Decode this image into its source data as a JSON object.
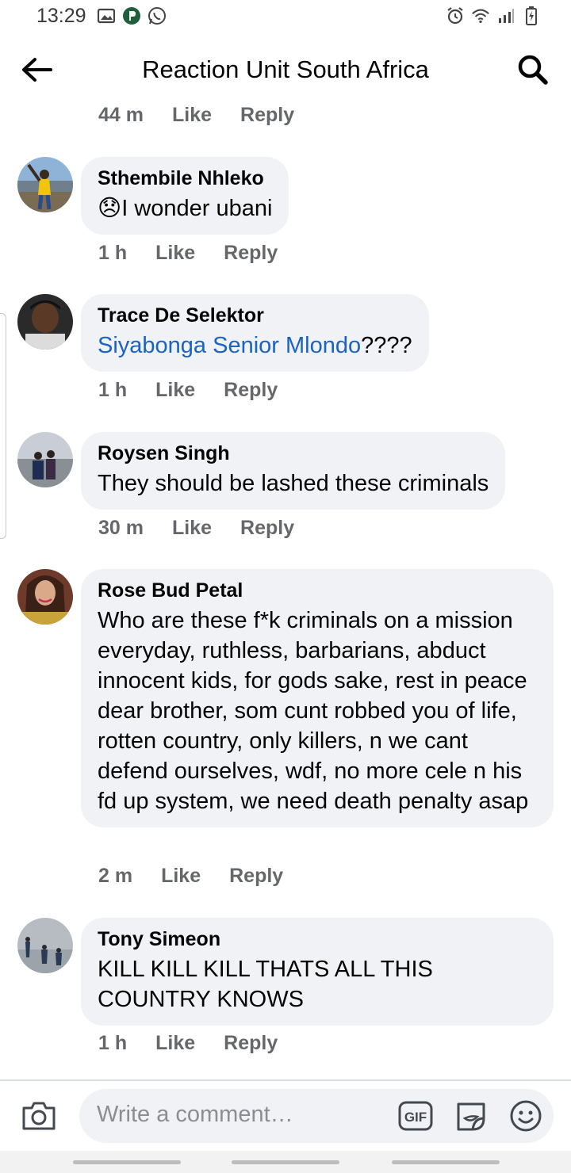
{
  "status_bar": {
    "time": "13:29",
    "left_icons": [
      "gallery-icon",
      "app-p-icon",
      "whatsapp-icon"
    ],
    "right_icons": [
      "alarm-icon",
      "wifi-icon",
      "signal-icon",
      "battery-charging-icon"
    ]
  },
  "header": {
    "title": "Reaction Unit South Africa",
    "back_icon": "arrow-left-icon",
    "search_icon": "search-icon"
  },
  "actions": {
    "like": "Like",
    "reply": "Reply"
  },
  "top_meta": {
    "time": "44 m"
  },
  "comments": [
    {
      "author": "Sthembile Nhleko",
      "emoji": "😞",
      "text": "I wonder ubani",
      "time": "1 h",
      "avatar": "avatar-sthembile"
    },
    {
      "author": "Trace De Selektor",
      "mention": "Siyabonga Senior Mlondo",
      "text": "????",
      "time": "1 h",
      "avatar": "avatar-trace"
    },
    {
      "author": "Roysen Singh",
      "text": "They should be lashed these criminals",
      "time": "30 m",
      "avatar": "avatar-roysen"
    },
    {
      "author": "Rose Bud Petal",
      "text": "Who are these f*k criminals on a mission everyday, ruthless, barbarians, abduct innocent kids, for gods sake, rest in peace dear brother, som cunt robbed you of life, rotten country, only killers, n we cant defend ourselves, wdf, no more cele n his fd up system, we need death penalty asap",
      "time": "2 m",
      "avatar": "avatar-rose"
    },
    {
      "author": "Tony Simeon",
      "text": "KILL KILL KILL THATS ALL THIS COUNTRY KNOWS",
      "time": "1 h",
      "avatar": "avatar-tony"
    }
  ],
  "composer": {
    "placeholder": "Write a comment…",
    "gif_label": "GIF",
    "camera_icon": "camera-icon",
    "sticker_icon": "sticker-icon",
    "emoji_icon": "emoji-icon"
  }
}
